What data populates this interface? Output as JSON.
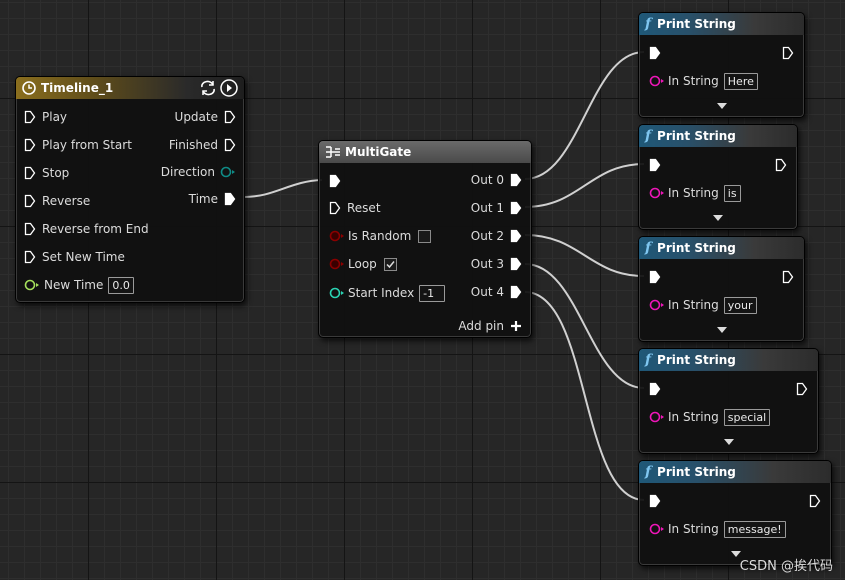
{
  "timeline": {
    "title": "Timeline_1",
    "inputs": [
      "Play",
      "Play from Start",
      "Stop",
      "Reverse",
      "Reverse from End",
      "Set New Time"
    ],
    "new_time_label": "New Time",
    "new_time_value": "0.0",
    "outputs": [
      "Update",
      "Finished",
      "Direction",
      "Time"
    ]
  },
  "multigate": {
    "title": "MultiGate",
    "reset_label": "Reset",
    "is_random_label": "Is Random",
    "is_random_checked": false,
    "loop_label": "Loop",
    "loop_checked": true,
    "start_index_label": "Start Index",
    "start_index_value": "-1",
    "outputs": [
      "Out 0",
      "Out 1",
      "Out 2",
      "Out 3",
      "Out 4"
    ],
    "add_pin_label": "Add pin"
  },
  "print_nodes": [
    {
      "title": "Print String",
      "in_string_label": "In String",
      "value": "Here"
    },
    {
      "title": "Print String",
      "in_string_label": "In String",
      "value": "is"
    },
    {
      "title": "Print String",
      "in_string_label": "In String",
      "value": "your"
    },
    {
      "title": "Print String",
      "in_string_label": "In String",
      "value": "special"
    },
    {
      "title": "Print String",
      "in_string_label": "In String",
      "value": "message!"
    }
  ],
  "watermark": "CSDN @挨代码",
  "colors": {
    "exec_pin": "#ffffff",
    "float_pin": "#a6e05c",
    "bool_pin": "#8b0000",
    "int_pin": "#2bd4b4",
    "string_pin": "#ee16b8",
    "timeline_header": "#8a6e1e",
    "function_header": "#1f5878"
  }
}
